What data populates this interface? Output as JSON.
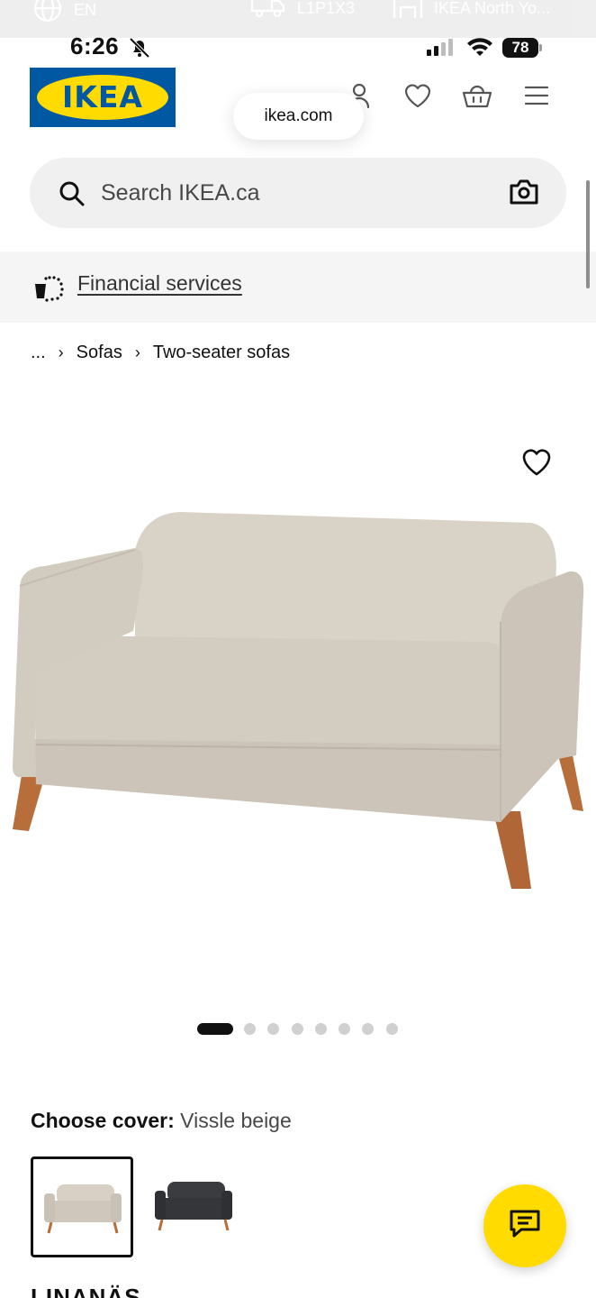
{
  "top_strip": {
    "language": "EN",
    "postal_code": "L1P1X3",
    "store": "IKEA North Yo..."
  },
  "status_bar": {
    "time": "6:26",
    "battery": "78"
  },
  "header": {
    "logo_text": "IKEA",
    "url": "ikea.com",
    "search_placeholder": "Search IKEA.ca"
  },
  "financial": {
    "label": "Financial services"
  },
  "breadcrumb": {
    "ellipsis": "...",
    "items": [
      "Sofas",
      "Two-seater sofas"
    ]
  },
  "carousel": {
    "total_images": 8,
    "active_index": 0
  },
  "cover": {
    "label": "Choose cover:",
    "value": "Vissle beige",
    "options": [
      {
        "name": "Vissle beige",
        "color": "#d8d0c4",
        "selected": true
      },
      {
        "name": "dark grey",
        "color": "#3a3c40",
        "selected": false
      }
    ]
  },
  "product": {
    "name": "LINANÄS"
  },
  "colors": {
    "ikea_blue": "#0058a3",
    "ikea_yellow": "#ffdb00",
    "sofa_fabric": "#d6cfc4",
    "leg_wood": "#b86e3a"
  }
}
